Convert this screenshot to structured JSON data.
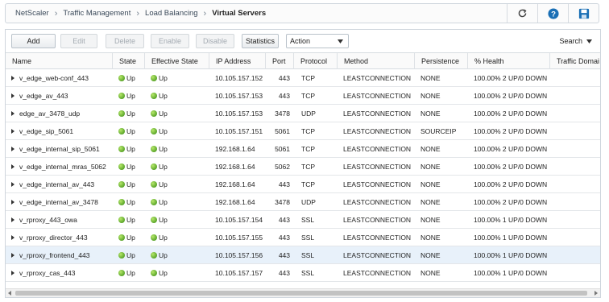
{
  "breadcrumb": [
    "NetScaler",
    "Traffic Management",
    "Load Balancing"
  ],
  "breadcrumb_current": "Virtual Servers",
  "icons": {
    "refresh": "refresh-icon",
    "help": "help-icon",
    "save": "save-icon"
  },
  "toolbar": {
    "add": "Add",
    "edit": "Edit",
    "delete": "Delete",
    "enable": "Enable",
    "disable": "Disable",
    "statistics": "Statistics",
    "action": "Action",
    "search": "Search"
  },
  "columns": [
    "Name",
    "State",
    "Effective State",
    "IP Address",
    "Port",
    "Protocol",
    "Method",
    "Persistence",
    "% Health",
    "Traffic Domai"
  ],
  "rows": [
    {
      "name": "v_edge_web-conf_443",
      "state": "Up",
      "effective": "Up",
      "ip": "10.105.157.152",
      "port": "443",
      "protocol": "TCP",
      "method": "LEASTCONNECTION",
      "persistence": "NONE",
      "health": "100.00% 2 UP/0 DOWN"
    },
    {
      "name": "v_edge_av_443",
      "state": "Up",
      "effective": "Up",
      "ip": "10.105.157.153",
      "port": "443",
      "protocol": "TCP",
      "method": "LEASTCONNECTION",
      "persistence": "NONE",
      "health": "100.00% 2 UP/0 DOWN"
    },
    {
      "name": "edge_av_3478_udp",
      "state": "Up",
      "effective": "Up",
      "ip": "10.105.157.153",
      "port": "3478",
      "protocol": "UDP",
      "method": "LEASTCONNECTION",
      "persistence": "NONE",
      "health": "100.00% 2 UP/0 DOWN"
    },
    {
      "name": "v_edge_sip_5061",
      "state": "Up",
      "effective": "Up",
      "ip": "10.105.157.151",
      "port": "5061",
      "protocol": "TCP",
      "method": "LEASTCONNECTION",
      "persistence": "SOURCEIP",
      "health": "100.00% 2 UP/0 DOWN"
    },
    {
      "name": "v_edge_internal_sip_5061",
      "state": "Up",
      "effective": "Up",
      "ip": "192.168.1.64",
      "port": "5061",
      "protocol": "TCP",
      "method": "LEASTCONNECTION",
      "persistence": "NONE",
      "health": "100.00% 2 UP/0 DOWN"
    },
    {
      "name": "v_edge_internal_mras_5062",
      "state": "Up",
      "effective": "Up",
      "ip": "192.168.1.64",
      "port": "5062",
      "protocol": "TCP",
      "method": "LEASTCONNECTION",
      "persistence": "NONE",
      "health": "100.00% 2 UP/0 DOWN"
    },
    {
      "name": "v_edge_internal_av_443",
      "state": "Up",
      "effective": "Up",
      "ip": "192.168.1.64",
      "port": "443",
      "protocol": "TCP",
      "method": "LEASTCONNECTION",
      "persistence": "NONE",
      "health": "100.00% 2 UP/0 DOWN"
    },
    {
      "name": "v_edge_internal_av_3478",
      "state": "Up",
      "effective": "Up",
      "ip": "192.168.1.64",
      "port": "3478",
      "protocol": "UDP",
      "method": "LEASTCONNECTION",
      "persistence": "NONE",
      "health": "100.00% 2 UP/0 DOWN"
    },
    {
      "name": "v_rproxy_443_owa",
      "state": "Up",
      "effective": "Up",
      "ip": "10.105.157.154",
      "port": "443",
      "protocol": "SSL",
      "method": "LEASTCONNECTION",
      "persistence": "NONE",
      "health": "100.00% 1 UP/0 DOWN"
    },
    {
      "name": "v_rproxy_director_443",
      "state": "Up",
      "effective": "Up",
      "ip": "10.105.157.155",
      "port": "443",
      "protocol": "SSL",
      "method": "LEASTCONNECTION",
      "persistence": "NONE",
      "health": "100.00% 1 UP/0 DOWN"
    },
    {
      "name": "v_rproxy_frontend_443",
      "state": "Up",
      "effective": "Up",
      "ip": "10.105.157.156",
      "port": "443",
      "protocol": "SSL",
      "method": "LEASTCONNECTION",
      "persistence": "NONE",
      "health": "100.00% 1 UP/0 DOWN"
    },
    {
      "name": "v_rproxy_cas_443",
      "state": "Up",
      "effective": "Up",
      "ip": "10.105.157.157",
      "port": "443",
      "protocol": "SSL",
      "method": "LEASTCONNECTION",
      "persistence": "NONE",
      "health": "100.00% 1 UP/0 DOWN"
    }
  ],
  "highlighted_row": 10,
  "colors": {
    "accent": "#1a6fb5",
    "status_up": "#5aa52a",
    "row_highlight": "#e8f1fa"
  }
}
